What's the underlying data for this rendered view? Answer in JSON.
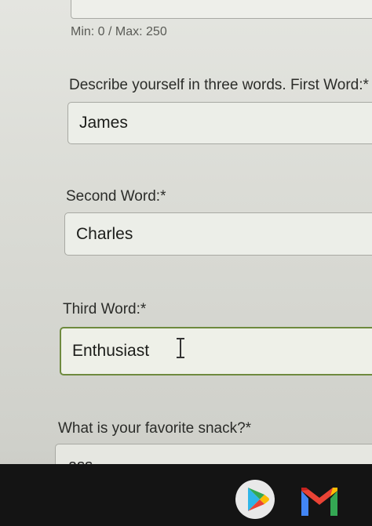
{
  "form": {
    "previous_hint": "Min: 0 / Max: 250",
    "first_word": {
      "label": "Describe yourself in three words. First Word:",
      "required_mark": "*",
      "value": "James"
    },
    "second_word": {
      "label": "Second Word:",
      "required_mark": "*",
      "value": "Charles"
    },
    "third_word": {
      "label": "Third Word:",
      "required_mark": "*",
      "value": "Enthusiast"
    },
    "snack": {
      "label": "What is your favorite snack?",
      "required_mark": "*",
      "value": "ass"
    }
  },
  "taskbar": {
    "icons": [
      "play-store-icon",
      "gmail-icon"
    ]
  },
  "colors": {
    "focus_border": "#6e8a3e",
    "taskbar_bg": "#141414"
  }
}
